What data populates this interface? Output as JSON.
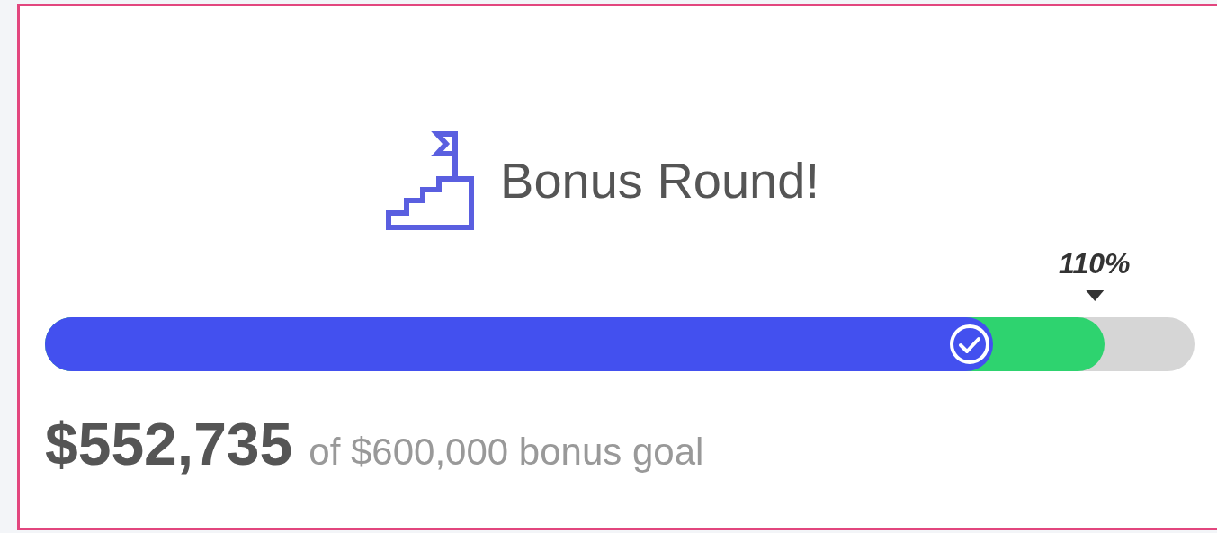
{
  "card": {
    "title": "Bonus Round!",
    "progress": {
      "segments": [
        {
          "level": 0.922,
          "color": "#2ed36f",
          "checked": false
        },
        {
          "level": 0.825,
          "color": "#4350ef",
          "checked": true
        }
      ],
      "marker": {
        "label": "110%",
        "level": 0.913
      }
    },
    "amount": "$552,735",
    "caption": "of $600,000 bonus goal"
  }
}
